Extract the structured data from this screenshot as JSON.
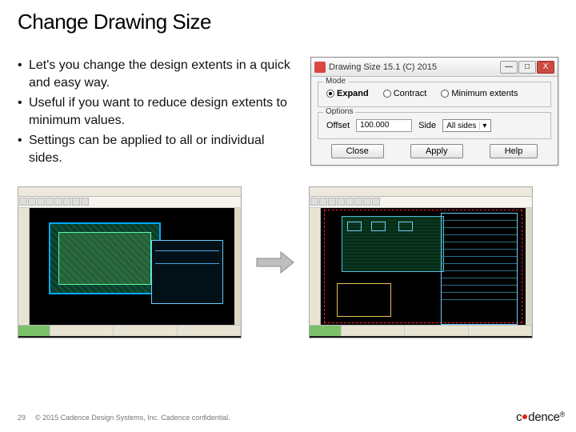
{
  "title": "Change Drawing Size",
  "bullets": [
    "Let's you change the design extents in a quick and easy way.",
    "Useful if you want to reduce design extents to minimum values.",
    "Settings can be applied to all or individual sides."
  ],
  "dialog": {
    "title": "Drawing Size 15.1 (C) 2015",
    "win": {
      "min": "—",
      "max": "□",
      "close": "X"
    },
    "mode": {
      "legend": "Mode",
      "expand": "Expand",
      "contract": "Contract",
      "minext": "Minimum extents"
    },
    "options": {
      "legend": "Options",
      "offset_label": "Offset",
      "offset_value": "100.000",
      "side_label": "Side",
      "side_value": "All sides"
    },
    "buttons": {
      "close": "Close",
      "apply": "Apply",
      "help": "Help"
    }
  },
  "footer": {
    "page": "29",
    "copyright": "© 2015 Cadence Design Systems, Inc. Cadence confidential.",
    "brand_c": "c",
    "brand_a": "a",
    "brand_rest": "dence"
  }
}
